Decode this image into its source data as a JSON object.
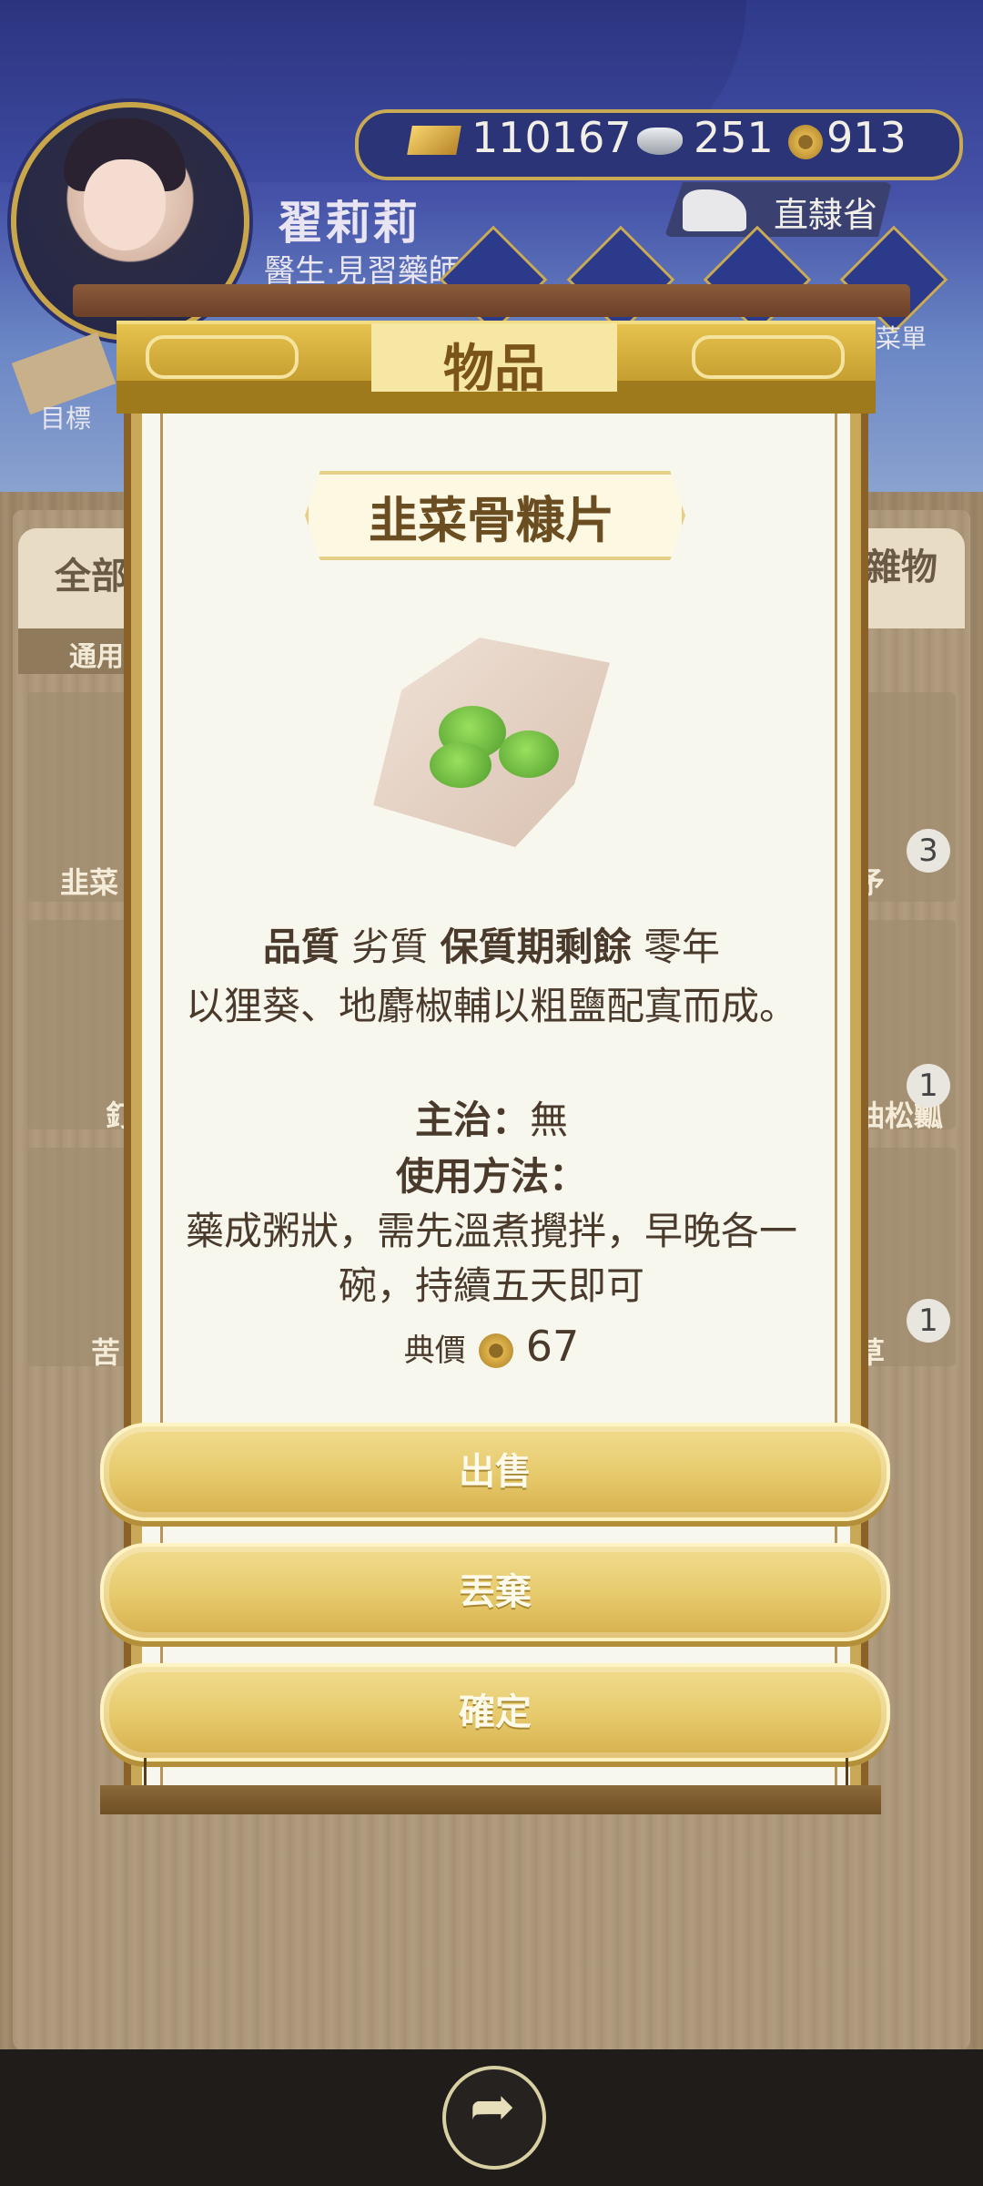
{
  "player": {
    "name": "翟莉莉",
    "title": "醫生·見習藥師",
    "location": "直隸省"
  },
  "resources": {
    "gold": "110167",
    "silver": "251",
    "coins": "913"
  },
  "side": {
    "target_label": "目標",
    "menu_label": "菜單",
    "tab_all": "全部",
    "tab_misc": "雜物",
    "subtab": "通用",
    "left_items": [
      "韭菜",
      "釘",
      "苦"
    ],
    "right_items": [
      "矛",
      "油松瓤",
      "草"
    ],
    "right_counts": [
      "3",
      "1",
      "1"
    ]
  },
  "modal": {
    "header": "物品",
    "item_name": "韭菜骨糠片",
    "quality_label": "品質",
    "quality_value": "劣質",
    "shelf_label": "保質期剩餘",
    "shelf_value": "零年",
    "description": "以狸葵、地麝椒輔以粗鹽配寘而成。",
    "treat_label": "主治：",
    "treat_value": "無",
    "usage_label": "使用方法：",
    "usage_text": "藥成粥狀，需先溫煮攪拌，早晚各一碗，持續五天即可",
    "price_label": "典價",
    "price_value": "67",
    "buttons": {
      "sell": "出售",
      "discard": "丟棄",
      "confirm": "確定"
    }
  },
  "colors": {
    "button": "#e6c96b",
    "paper": "#f8f7ee",
    "header_gold": "#c19a2c"
  },
  "icons": [
    "gold-ingot-icon",
    "silver-ingot-icon",
    "copper-coin-icon",
    "share-icon"
  ]
}
